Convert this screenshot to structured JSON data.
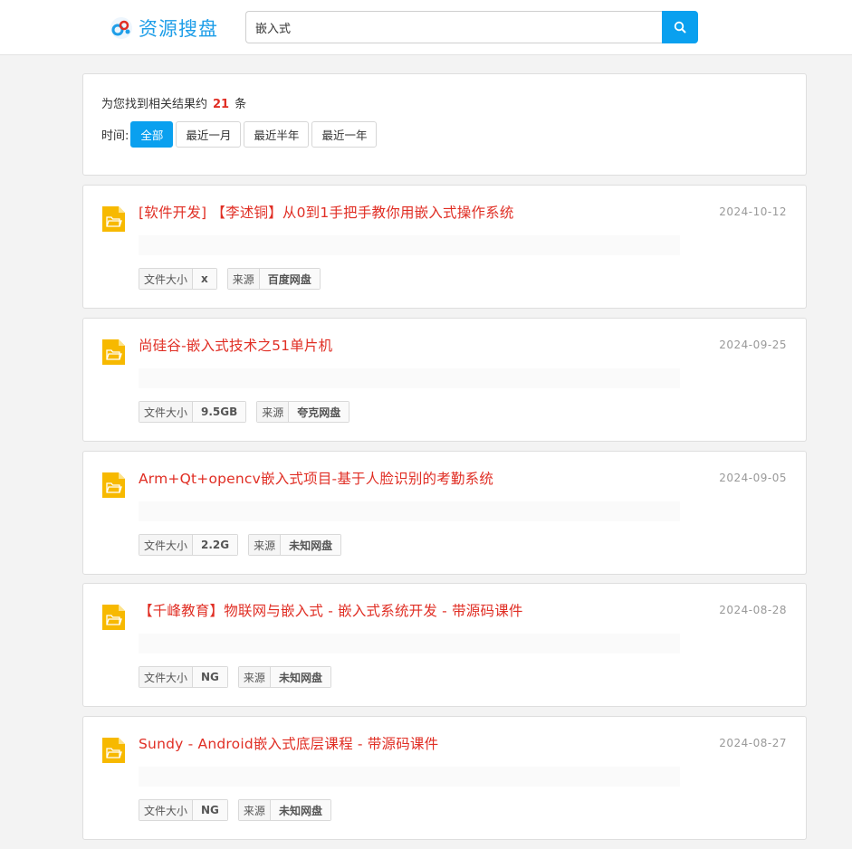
{
  "header": {
    "logo_text": "资源搜盘",
    "search_value": "嵌入式",
    "search_icon": "search-icon",
    "accent": "#0aa0ef"
  },
  "summary": {
    "prefix": "为您找到相关结果约",
    "count": "21",
    "suffix": "条",
    "time_label": "时间:",
    "time_filters": [
      "全部",
      "最近一月",
      "最近半年",
      "最近一年"
    ],
    "active_filter": "全部"
  },
  "labels": {
    "size": "文件大小",
    "source": "来源"
  },
  "results": [
    {
      "title": "[软件开发] 【李述铜】从0到1手把手教你用嵌入式操作系统",
      "date": "2024-10-12",
      "size": "x",
      "source": "百度网盘"
    },
    {
      "title": "尚硅谷-嵌入式技术之51单片机",
      "date": "2024-09-25",
      "size": "9.5GB",
      "source": "夸克网盘"
    },
    {
      "title": "Arm+Qt+opencv嵌入式项目-基于人脸识别的考勤系统",
      "date": "2024-09-05",
      "size": "2.2G",
      "source": "未知网盘"
    },
    {
      "title": "【千峰教育】物联网与嵌入式 - 嵌入式系统开发 - 带源码课件",
      "date": "2024-08-28",
      "size": "NG",
      "source": "未知网盘"
    },
    {
      "title": "Sundy - Android嵌入式底层课程 - 带源码课件",
      "date": "2024-08-27",
      "size": "NG",
      "source": "未知网盘"
    }
  ],
  "colors": {
    "title": "#e02e24",
    "folder": "#f7b900",
    "date": "#999999"
  }
}
